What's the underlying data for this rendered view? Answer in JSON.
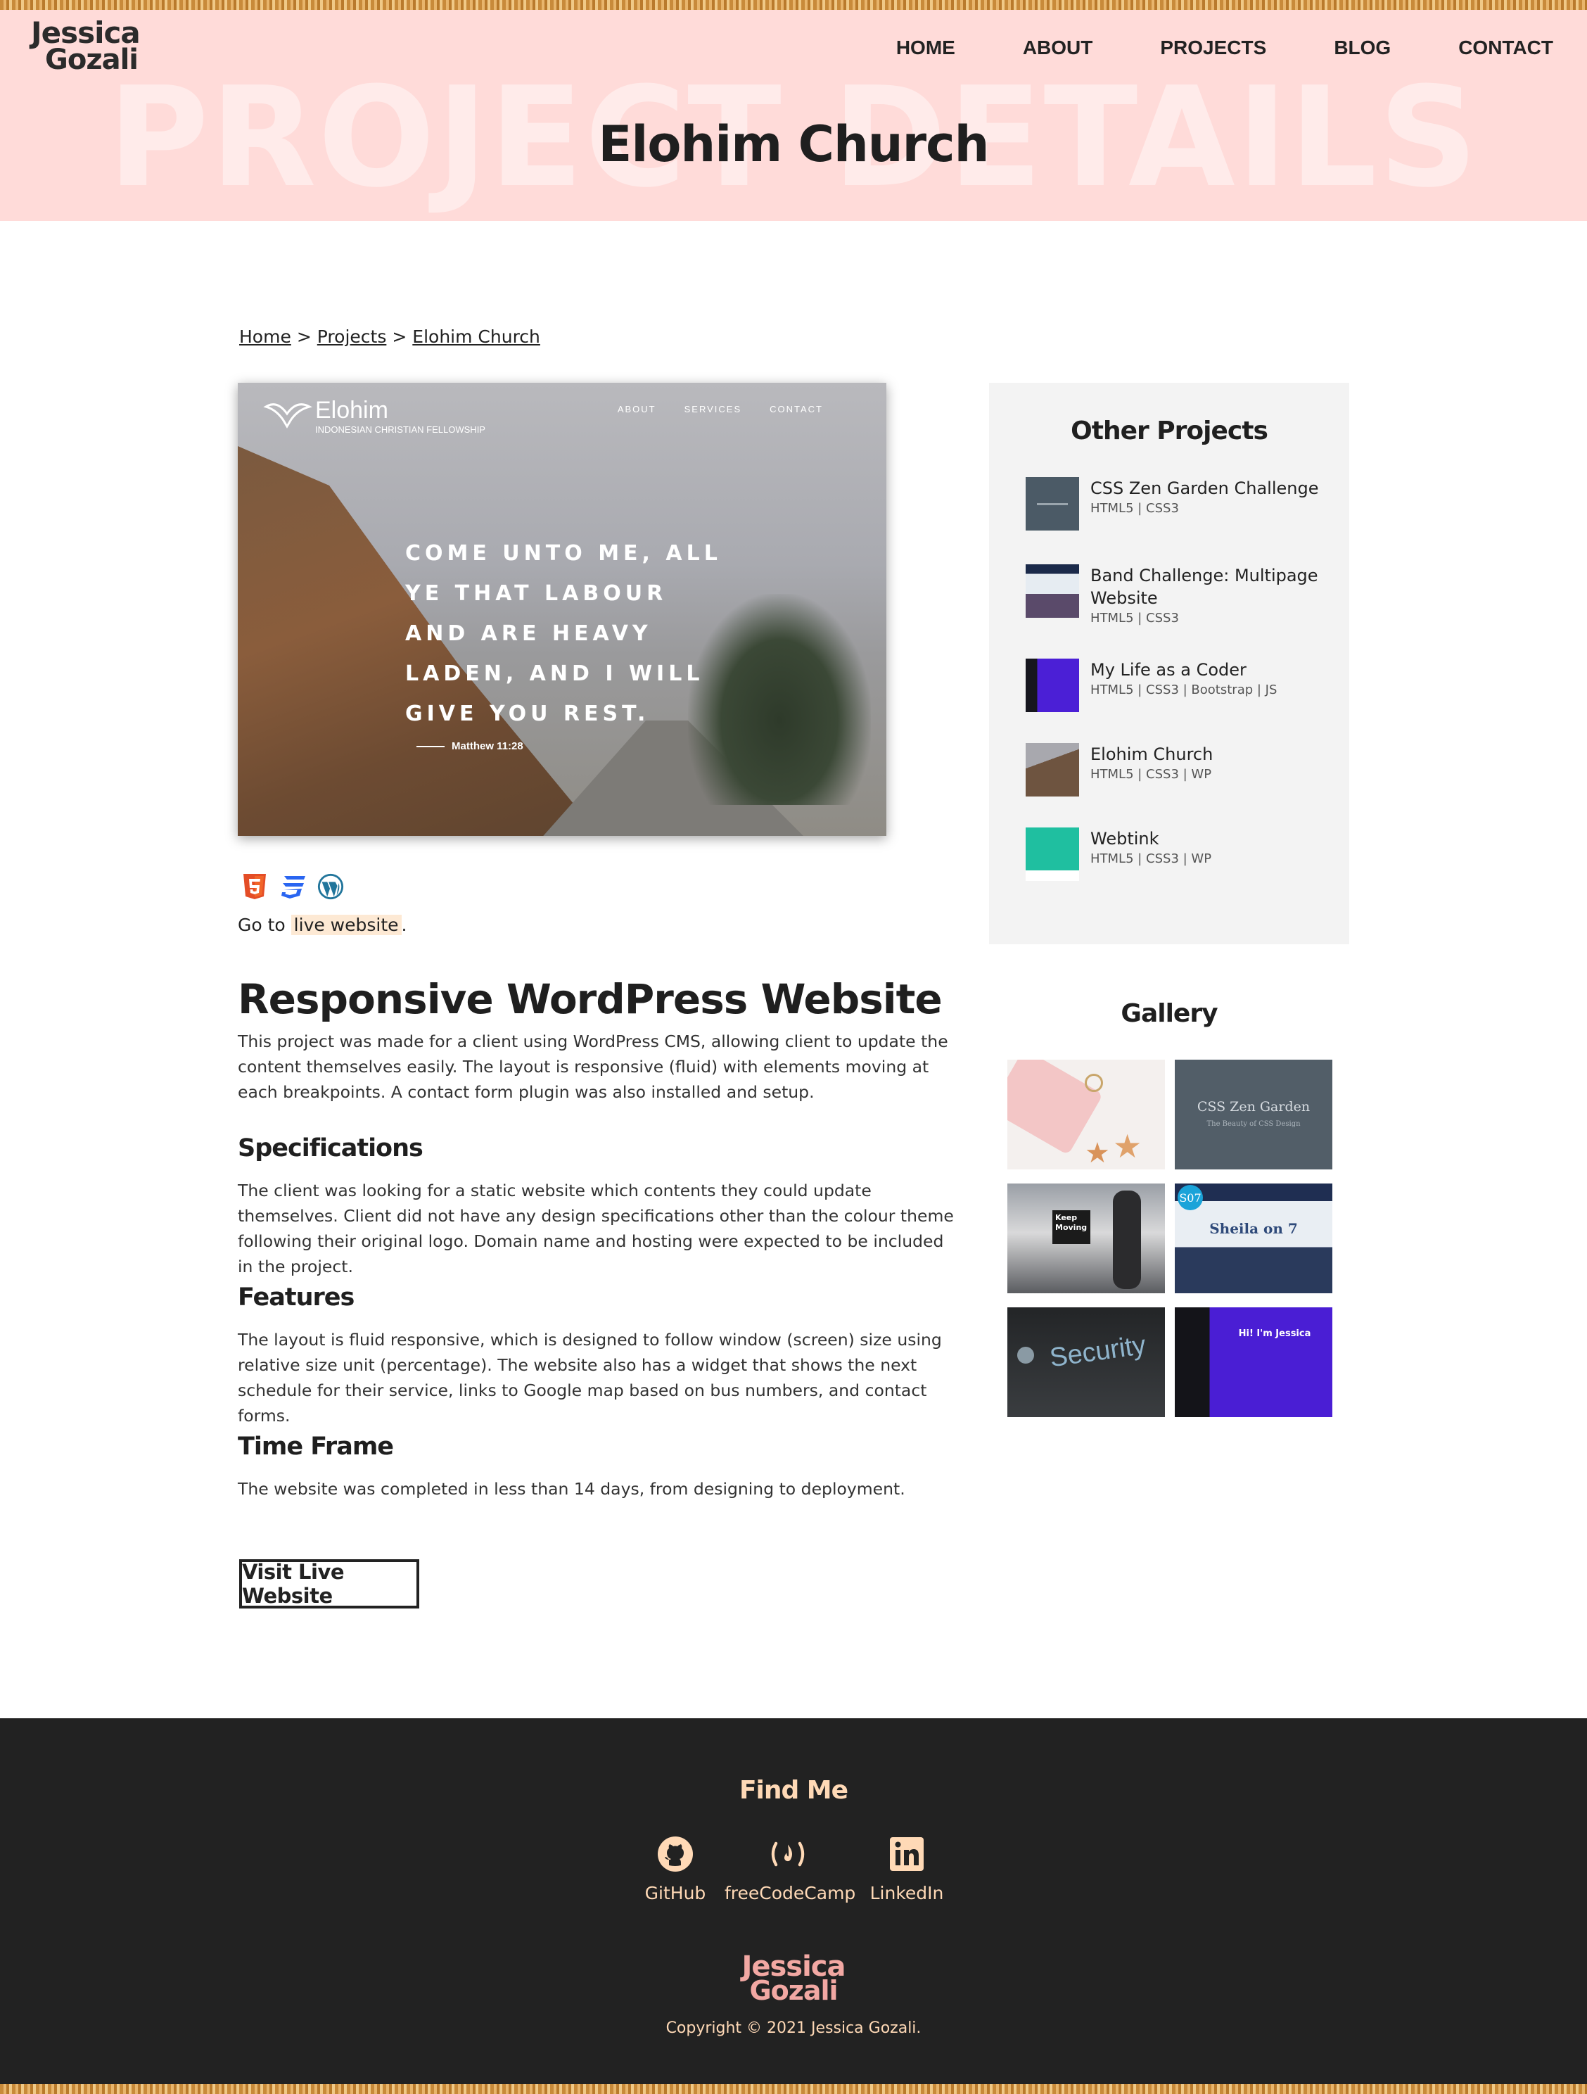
{
  "header": {
    "logo_line1": "Jessica",
    "logo_line2": "Gozali",
    "nav": [
      "HOME",
      "ABOUT",
      "PROJECTS",
      "BLOG",
      "CONTACT"
    ],
    "ghost_text": "PROJECT DETAILS",
    "title": "Elohim Church"
  },
  "breadcrumb": {
    "items": [
      "Home",
      "Projects",
      "Elohim Church"
    ],
    "separator": ">"
  },
  "screenshot": {
    "brand": "Elohim",
    "brand_sub": "INDONESIAN CHRISTIAN FELLOWSHIP",
    "nav": [
      "ABOUT",
      "SERVICES",
      "CONTACT"
    ],
    "quote": "COME UNTO ME, ALL YE THAT LABOUR AND ARE HEAVY LADEN, AND I WILL GIVE YOU REST.",
    "quote_ref": "Matthew 11:28"
  },
  "tech_icons": [
    "html5-icon",
    "css3-icon",
    "wordpress-icon"
  ],
  "goto": {
    "prefix": "Go to ",
    "link": "live website",
    "suffix": "."
  },
  "main": {
    "heading": "Responsive WordPress Website",
    "intro": "This project was made for a client using WordPress CMS, allowing client to update the content themselves easily. The layout is responsive (fluid) with elements moving at each breakpoints. A contact form plugin was also installed and setup.",
    "spec_heading": "Specifications",
    "spec_text": "The client was looking for a static website which contents they could update themselves. Client did not have any design specifications other than the colour theme following their original logo. Domain name and hosting were expected to be included in the project.",
    "features_heading": "Features",
    "features_text": "The layout is fluid responsive, which is designed to follow window (screen) size using relative size unit (percentage). The website also has a widget that shows the next schedule for their service, links to Google map based on bus numbers, and contact forms.",
    "timeframe_heading": "Time Frame",
    "timeframe_text": "The website was completed in less than 14 days, from designing to deployment.",
    "button": "Visit Live Website"
  },
  "sidebar": {
    "title": "Other Projects",
    "projects": [
      {
        "title": "CSS Zen Garden Challenge",
        "tags": "HTML5 | CSS3"
      },
      {
        "title": "Band Challenge: Multipage Website",
        "tags": "HTML5 | CSS3"
      },
      {
        "title": "My Life as a Coder",
        "tags": "HTML5 | CSS3 | Bootstrap | JS"
      },
      {
        "title": "Elohim Church",
        "tags": "HTML5 | CSS3 | WP"
      },
      {
        "title": "Webtink",
        "tags": "HTML5 | CSS3 | WP"
      }
    ]
  },
  "gallery": {
    "title": "Gallery",
    "zen_title": "CSS Zen Garden",
    "zen_sub": "The Beauty of CSS Design",
    "keep_moving": "Keep Moving",
    "band_logo": "S07",
    "band_title": "Sheila on 7",
    "security": "Security",
    "coder_hi": "Hi! I'm Jessica"
  },
  "footer": {
    "title": "Find Me",
    "links": [
      "GitHub",
      "freeCodeCamp",
      "LinkedIn"
    ],
    "logo_line1": "Jessica",
    "logo_line2": "Gozali",
    "copyright": "Copyright © 2021 Jessica Gozali."
  }
}
